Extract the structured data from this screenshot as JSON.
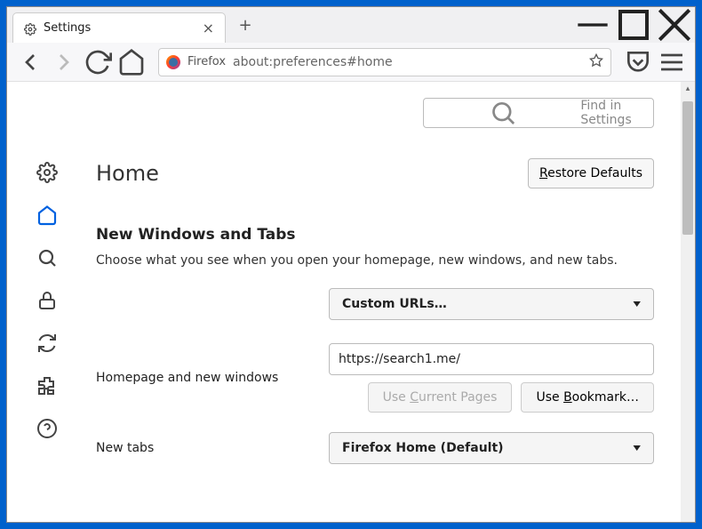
{
  "tab": {
    "title": "Settings"
  },
  "urlbar": {
    "label": "Firefox",
    "url": "about:preferences#home"
  },
  "search": {
    "placeholder": "Find in Settings"
  },
  "page": {
    "heading": "Home",
    "restore_label": "Restore Defaults",
    "section_title": "New Windows and Tabs",
    "section_desc": "Choose what you see when you open your homepage, new windows, and new tabs."
  },
  "homepage": {
    "label": "Homepage and new windows",
    "select_value": "Custom URLs…",
    "input_value": "https://search1.me/",
    "use_current": "Use Current Pages",
    "use_bookmark": "Use Bookmark…"
  },
  "newtabs": {
    "label": "New tabs",
    "select_value": "Firefox Home (Default)"
  },
  "sidebar": {
    "items": [
      {
        "name": "general-icon"
      },
      {
        "name": "home-icon"
      },
      {
        "name": "search-icon"
      },
      {
        "name": "privacy-icon"
      },
      {
        "name": "sync-icon"
      },
      {
        "name": "extensions-icon"
      },
      {
        "name": "help-icon"
      }
    ]
  },
  "colors": {
    "accent": "#0061e0"
  }
}
